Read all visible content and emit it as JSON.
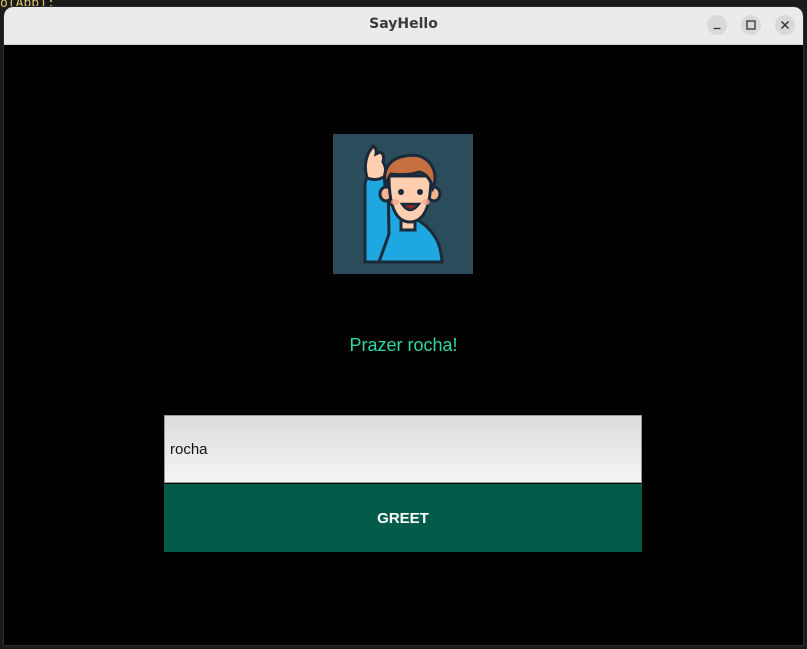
{
  "window": {
    "title": "SayHello",
    "controls": {
      "minimize_icon": "minimize-icon",
      "maximize_icon": "maximize-icon",
      "close_icon": "close-icon"
    }
  },
  "background": {
    "code_snippet": "o(App);"
  },
  "main": {
    "avatar_icon": "waving-man-avatar",
    "greeting": "Prazer rocha!",
    "name_input_value": "rocha",
    "greet_button_label": "GREET"
  },
  "colors": {
    "window_bg": "#000000",
    "greeting_text": "#2ed8a8",
    "button_bg": "#025c49",
    "button_text": "#ffffff",
    "avatar_bg": "#2b4d5b"
  }
}
